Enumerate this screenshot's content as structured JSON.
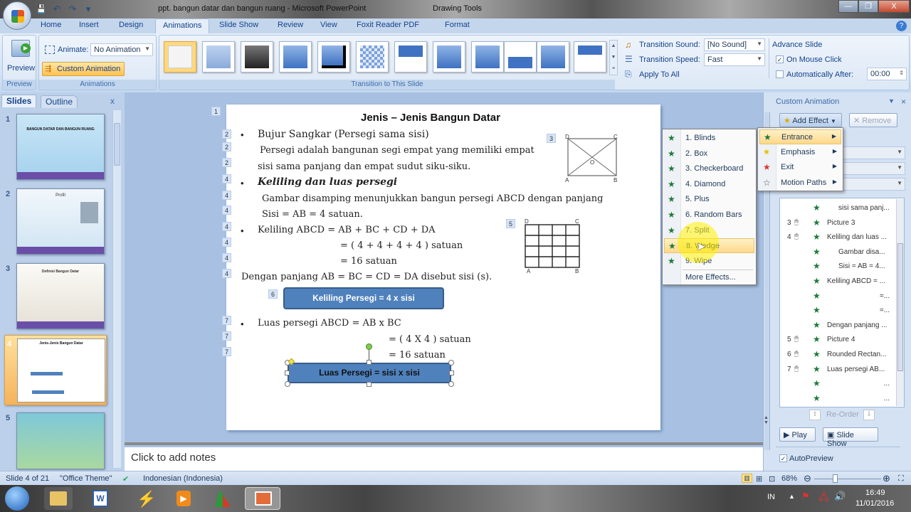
{
  "window": {
    "title": "ppt. bangun datar dan bangun ruang - Microsoft PowerPoint",
    "contextual_tools": "Drawing Tools",
    "controls": {
      "minimize": "—",
      "restore": "❐",
      "close": "X"
    }
  },
  "quick_access": {
    "save": "💾",
    "undo": "↶",
    "redo": "↷",
    "customize": "▾"
  },
  "ribbon_tabs": [
    {
      "label": "Home"
    },
    {
      "label": "Insert"
    },
    {
      "label": "Design"
    },
    {
      "label": "Animations",
      "active": true
    },
    {
      "label": "Slide Show"
    },
    {
      "label": "Review"
    },
    {
      "label": "View"
    },
    {
      "label": "Foxit Reader PDF"
    },
    {
      "label": "Format"
    }
  ],
  "ribbon": {
    "preview_group": {
      "button": "Preview",
      "label": "Preview"
    },
    "animations_group": {
      "animate_label": "Animate:",
      "animate_value": "No Animation",
      "custom_animation": "Custom Animation",
      "label": "Animations"
    },
    "transition_group": {
      "label": "Transition to This Slide",
      "sound_label": "Transition Sound:",
      "sound_value": "[No Sound]",
      "speed_label": "Transition Speed:",
      "speed_value": "Fast",
      "apply_all": "Apply To All"
    },
    "advance_group": {
      "title": "Advance Slide",
      "on_mouse_click": "On Mouse Click",
      "on_mouse_click_checked": true,
      "auto_after": "Automatically After:",
      "auto_after_checked": false,
      "auto_after_value": "00:00"
    }
  },
  "left_pane": {
    "tabs": [
      {
        "label": "Slides",
        "active": true
      },
      {
        "label": "Outline"
      }
    ],
    "close": "x",
    "slides": [
      {
        "num": "1",
        "title": "BANGUN DATAR DAN BANGUN RUANG"
      },
      {
        "num": "2",
        "title": "Profil"
      },
      {
        "num": "3",
        "title": "Definisi Bangun Datar"
      },
      {
        "num": "4",
        "title": "Jenis-Jenis Bangun Datar",
        "selected": true
      },
      {
        "num": "5",
        "title": ""
      }
    ]
  },
  "slide": {
    "title": "Jenis – Jenis  Bangun Datar",
    "lines": [
      "Bujur Sangkar (Persegi sama sisi)",
      "Persegi  adalah  bangunan  segi  empat  yang  memiliki  empat",
      "sisi sama panjang  dan empat sudut siku-siku.",
      "Keliling dan luas persegi",
      "Gambar disamping  menunjukkan  bangun  persegi  ABCD dengan  panjang",
      "Sisi  =  AB = 4  satuan.",
      "Keliling  ABCD = AB  +  BC +  CD +  DA",
      "=  ( 4 + 4 + 4 + 4 ) satuan",
      "= 16  satuan",
      "Dengan  panjang  AB = BC = CD = DA disebut  sisi  (s).",
      "Luas persegi  ABCD =  AB  x BC",
      "= ( 4 X 4 ) satuan",
      "= 16  satuan"
    ],
    "box1": "Keliling Persegi = 4 x sisi",
    "box2": "Luas Persegi = sisi x sisi",
    "anim_tags": [
      "1",
      "2",
      "2",
      "2",
      "4",
      "4",
      "4",
      "4",
      "4",
      "4",
      "4",
      "3",
      "5",
      "6",
      "7",
      "7",
      "7"
    ],
    "figure1_labels": {
      "D": "D",
      "C": "C",
      "A": "A",
      "B": "B",
      "O": "O"
    },
    "figure2_labels": {
      "D": "D",
      "C": "C",
      "A": "A",
      "B": "B"
    }
  },
  "notes": {
    "placeholder": "Click to add notes"
  },
  "task_pane": {
    "title": "Custom Animation",
    "add_effect": "Add Effect",
    "remove": "Remove",
    "list": [
      {
        "num": "",
        "text": "sisi sama panj...",
        "indent": 2
      },
      {
        "num": "3",
        "text": "Picture 3",
        "indent": 0
      },
      {
        "num": "4",
        "text": "Keliling dan luas ...",
        "indent": 0
      },
      {
        "num": "",
        "text": "Gambar disa...",
        "indent": 2
      },
      {
        "num": "",
        "text": "Sisi = AB = 4...",
        "indent": 2
      },
      {
        "num": "",
        "text": "Keliling ABCD = ...",
        "indent": 0
      },
      {
        "num": "",
        "text": "=...",
        "indent": 3
      },
      {
        "num": "",
        "text": "=...",
        "indent": 3
      },
      {
        "num": "",
        "text": "Dengan panjang ...",
        "indent": 0
      },
      {
        "num": "5",
        "text": "Picture 4",
        "indent": 0
      },
      {
        "num": "6",
        "text": "Rounded Rectan...",
        "indent": 0
      },
      {
        "num": "7",
        "text": "Luas persegi AB...",
        "indent": 0
      },
      {
        "num": "",
        "text": "...",
        "indent": 3
      },
      {
        "num": "",
        "text": "...",
        "indent": 3
      }
    ],
    "reorder": "Re-Order",
    "play": "Play",
    "slide_show": "Slide Show",
    "autopreview": "AutoPreview",
    "autopreview_checked": true
  },
  "effect_menu": {
    "categories": [
      {
        "label": "Entrance",
        "highlighted": true
      },
      {
        "label": "Emphasis"
      },
      {
        "label": "Exit"
      },
      {
        "label": "Motion Paths"
      }
    ],
    "entrance_effects": [
      {
        "label": "1. Blinds"
      },
      {
        "label": "2. Box"
      },
      {
        "label": "3. Checkerboard"
      },
      {
        "label": "4. Diamond"
      },
      {
        "label": "5. Plus"
      },
      {
        "label": "6. Random Bars"
      },
      {
        "label": "7. Split"
      },
      {
        "label": "8. Wedge",
        "highlighted": true
      },
      {
        "label": "9. Wipe"
      }
    ],
    "more": "More Effects..."
  },
  "status_bar": {
    "slide": "Slide 4 of 21",
    "theme": "\"Office Theme\"",
    "language": "Indonesian (Indonesia)",
    "zoom": "68%"
  },
  "taskbar": {
    "language": "IN",
    "time": "16:49",
    "date": "11/01/2016"
  }
}
